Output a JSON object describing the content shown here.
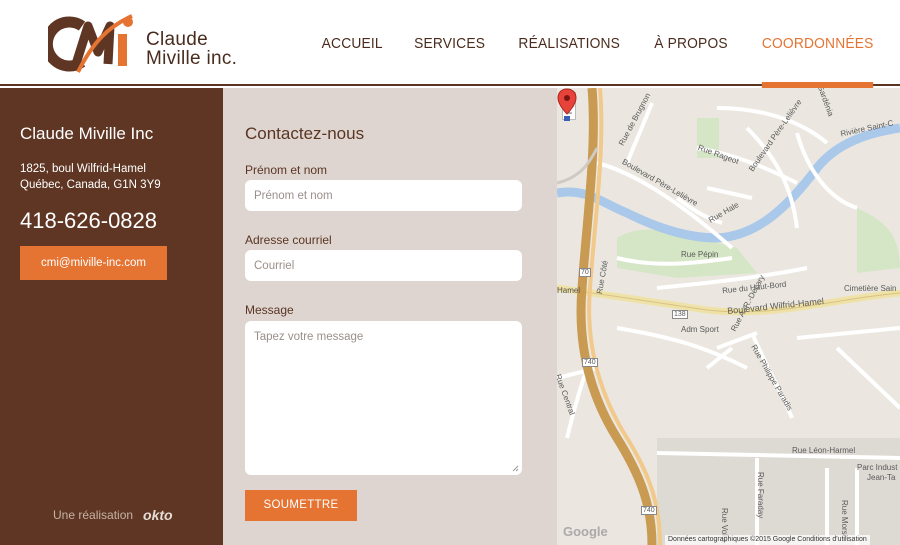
{
  "logo": {
    "line1": "Claude",
    "line2": "Miville inc."
  },
  "nav": [
    {
      "label": "ACCUEIL"
    },
    {
      "label": "SERVICES"
    },
    {
      "label": "RÉALISATIONS"
    },
    {
      "label": "À PROPOS"
    },
    {
      "label": "COORDONNÉES"
    }
  ],
  "contact": {
    "company": "Claude Miville Inc",
    "address1": "1825, boul Wilfrid-Hamel",
    "address2": "Québec, Canada, G1N 3Y9",
    "phone": "418-626-0828",
    "email": "cmi@miville-inc.com",
    "credit": "Une réalisation",
    "credit_brand": "okto"
  },
  "form": {
    "title": "Contactez-nous",
    "name_label": "Prénom et nom",
    "name_placeholder": "Prénom et nom",
    "email_label": "Adresse courriel",
    "email_placeholder": "Courriel",
    "message_label": "Message",
    "message_placeholder": "Tapez votre message",
    "submit": "SOUMETTRE"
  },
  "map": {
    "zoom_in": "+",
    "zoom_out": "−",
    "labels": {
      "rue_de_brugnon": "Rue de Brugnon",
      "rue_rageot": "Rue Rageot",
      "boul_pere_lelievre_1": "Boulevard Père-Lelièvre",
      "boul_pere_lelievre_2": "Boulevard Père-Lelièvre",
      "riviere": "Rivière Saint-C",
      "gardenia": "Gardénia",
      "rue_hale": "Rue Hale",
      "rue_pepin": "Rue Pépin",
      "rue_du_haut_bord": "Rue du Haut-Bord",
      "rue_cote": "Rue Côté",
      "boul_wilfrid_hamel": "Boulevard Wilfrid-Hamel",
      "adm_sport": "Adm Sport",
      "cimetiere": "Cimetière Sain",
      "rue_decary": "Rue A.-R.-Decary",
      "rue_philippe_paradis": "Rue Philippe Paradis",
      "rue_central": "Rue Central",
      "rue_leon_harmel": "Rue Léon-Harmel",
      "parc_industriel": "Parc Indust",
      "jean_ta": "Jean-Ta",
      "rue_faraday": "Rue Faraday",
      "rue_volta": "Rue Volta",
      "rue_morse": "Rue Morse",
      "hamel_short": "Hamel",
      "shield_70": "70",
      "shield_138": "138",
      "shield_740a": "740",
      "shield_740b": "740"
    },
    "google": "Google",
    "footer": "Données cartographiques ©2015 Google    Conditions d'utilisation"
  },
  "colors": {
    "brown": "#5e3623",
    "orange": "#e57332",
    "form_bg": "#ded5d1"
  }
}
